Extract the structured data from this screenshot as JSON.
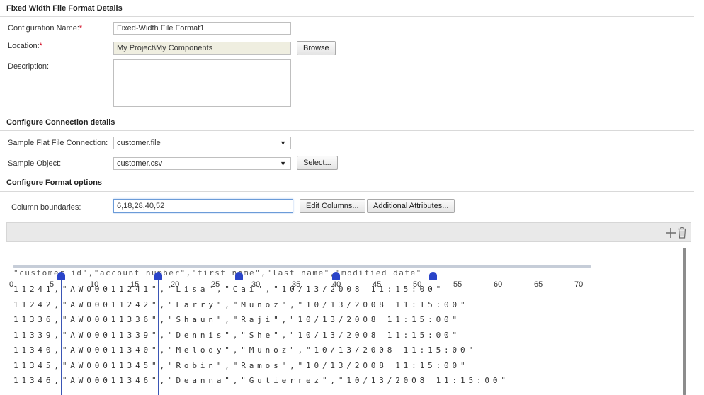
{
  "details": {
    "title": "Fixed Width File Format Details",
    "config_name_label": "Configuration Name:",
    "config_name_value": "Fixed-Width File Format1",
    "location_label": "Location:",
    "location_value": "My Project\\My Components",
    "browse_label": "Browse",
    "description_label": "Description:",
    "description_value": "",
    "required_mark": "*"
  },
  "connection": {
    "title": "Configure Connection details",
    "file_conn_label": "Sample Flat File Connection:",
    "file_conn_value": "customer.file",
    "object_label": "Sample Object:",
    "object_value": "customer.csv",
    "select_label": "Select...",
    "dropdown_arrow": "▼"
  },
  "format": {
    "title": "Configure Format options",
    "boundaries_label": "Column boundaries:",
    "boundaries_value": "6,18,28,40,52",
    "edit_columns_label": "Edit Columns...",
    "additional_attrs_label": "Additional Attributes..."
  },
  "toolbar": {
    "add_icon": "plus-icon",
    "delete_icon": "trash-icon"
  },
  "preview": {
    "header_text": "\"customer_id\",\"account_number\",\"first_name\",\"last_name\",\"modified_date\"",
    "ruler_ticks": [
      "0",
      "5",
      "10",
      "15",
      "20",
      "25",
      "30",
      "35",
      "40",
      "45",
      "50",
      "55",
      "60",
      "65",
      "70"
    ],
    "rows": [
      "11241,\"AW00011241\",\"Lisa\",\"Cai\",\"10/13/2008 11:15:00\"",
      "11242,\"AW00011242\",\"Larry\",\"Munoz\",\"10/13/2008 11:15:00\"",
      "11336,\"AW00011336\",\"Shaun\",\"Raji\",\"10/13/2008 11:15:00\"",
      "11339,\"AW00011339\",\"Dennis\",\"She\",\"10/13/2008 11:15:00\"",
      "11340,\"AW00011340\",\"Melody\",\"Munoz\",\"10/13/2008 11:15:00\"",
      "11345,\"AW00011345\",\"Robin\",\"Ramos\",\"10/13/2008 11:15:00\"",
      "11346,\"AW00011346\",\"Deanna\",\"Gutierrez\",\"10/13/2008 11:15:00\""
    ],
    "boundaries": [
      6,
      18,
      28,
      40,
      52
    ]
  },
  "colors": {
    "accent": "#2a44c8",
    "readonly_bg": "#efeee0",
    "strip_bg": "#e9e9e9"
  }
}
